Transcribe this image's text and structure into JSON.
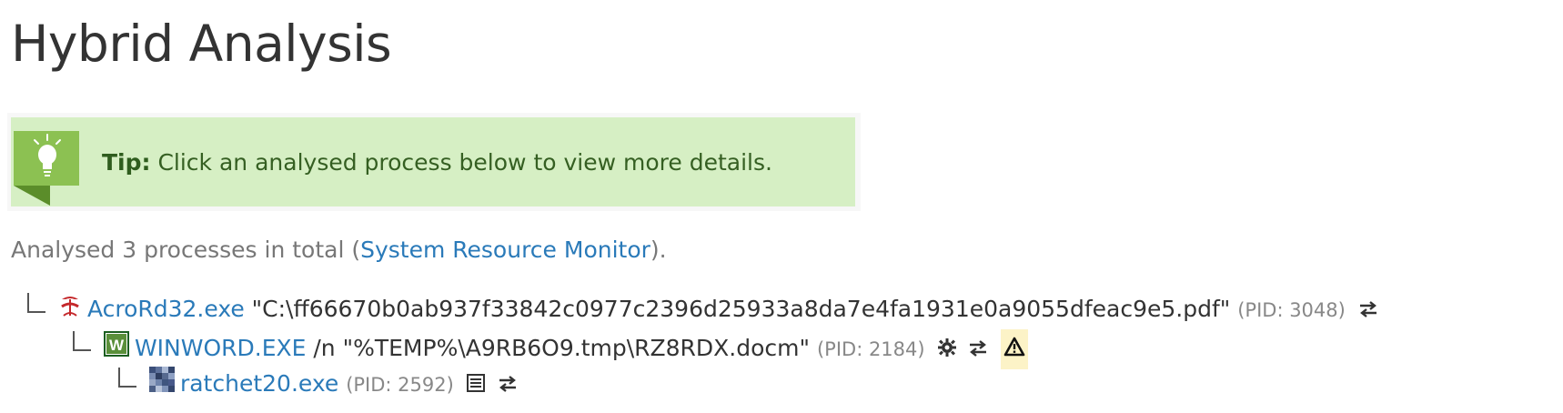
{
  "page": {
    "title": "Hybrid Analysis"
  },
  "tip": {
    "label": "Tip:",
    "text": " Click an analysed process below to view more details."
  },
  "summary": {
    "prefix": "Analysed 3 processes in total (",
    "link": "System Resource Monitor",
    "suffix": ")."
  },
  "processes": [
    {
      "name": "AcroRd32.exe",
      "args": " \"C:\\ff66670b0ab937f33842c0977c2396d25933a8da7e4fa1931e0a9055dfeac9e5.pdf\"",
      "pid": "(PID: 3048)",
      "icon": "pdf-reader-icon",
      "actions": [
        "network-icon"
      ]
    },
    {
      "name": "WINWORD.EXE",
      "args": " /n \"%TEMP%\\A9RB6O9.tmp\\RZ8RDX.docm\"",
      "pid": "(PID: 2184)",
      "icon": "word-icon",
      "actions": [
        "gear-icon",
        "network-icon",
        "warning-icon"
      ]
    },
    {
      "name": "ratchet20.exe",
      "args": "",
      "pid": "(PID: 2592)",
      "icon": "generic-exe-icon",
      "actions": [
        "list-icon",
        "network-icon"
      ]
    }
  ],
  "colors": {
    "link": "#2a7ab9",
    "tip_bg": "#d6efc4",
    "tip_icon_bg": "#8cc152",
    "tip_text": "#2f5d1e"
  }
}
